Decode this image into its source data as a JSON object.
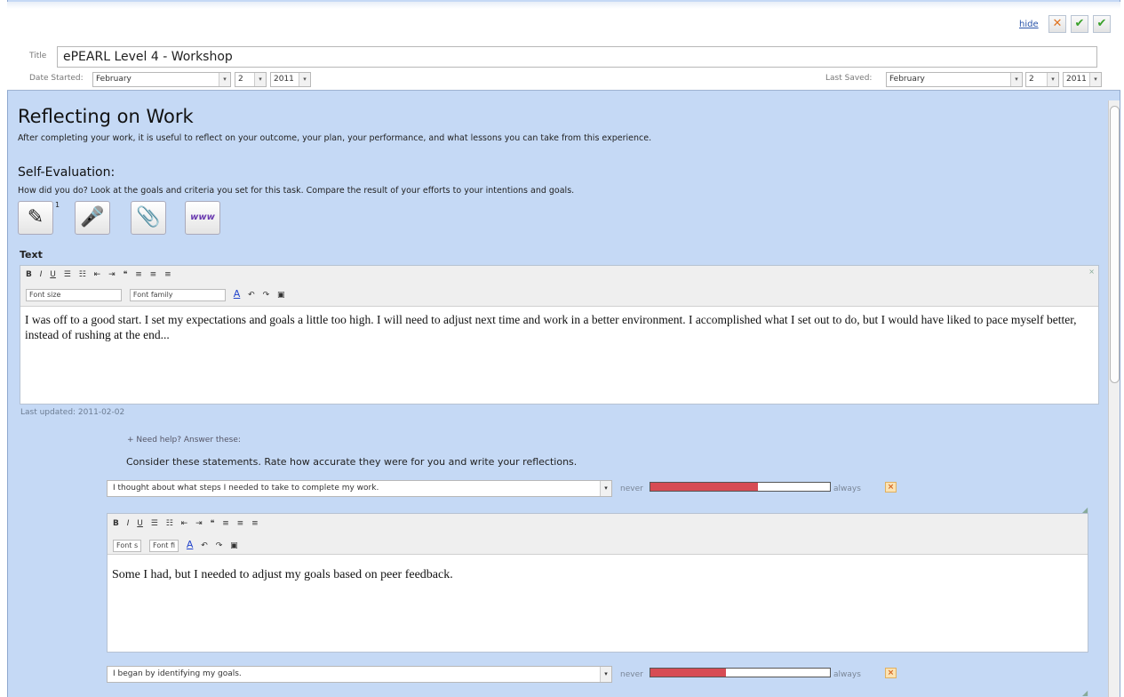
{
  "header": {
    "hide_label": "hide",
    "title_label": "Title",
    "title_value": "ePEARL Level 4 - Workshop",
    "date_started_label": "Date Started:",
    "date_started": {
      "month": "February",
      "day": "2",
      "year": "2011"
    },
    "last_saved_label": "Last Saved:",
    "last_saved": {
      "month": "February",
      "day": "2",
      "year": "2011"
    },
    "buttons": {
      "cancel_icon": "close-icon",
      "save_icon": "check-icon",
      "save_close_icon": "double-check-icon"
    }
  },
  "main": {
    "heading": "Reflecting on Work",
    "description": "After completing your work, it is useful to reflect on your outcome, your plan, your performance, and what lessons you can take from this experience.",
    "subheading": "Self-Evaluation:",
    "prompt": "How did you do? Look at the goals and criteria you set for this task. Compare the result of your efforts to your intentions and goals.",
    "tools": [
      {
        "name": "pencil-icon",
        "count": "1"
      },
      {
        "name": "microphone-icon"
      },
      {
        "name": "paperclip-icon"
      },
      {
        "name": "www-icon",
        "label": "www"
      }
    ],
    "text_label": "Text",
    "editor": {
      "font_size_placeholder": "Font size",
      "font_family_placeholder": "Font family",
      "content": "I was off to a good start. I set my expectations and goals a little too high. I will need to adjust next time and work in a better environment. I accomplished what I set out to do, but I would have liked to pace myself better, instead of rushing at the end..."
    },
    "last_updated": "Last updated: 2011-02-02",
    "need_help": "+ Need help? Answer these:",
    "consider": "Consider these statements. Rate how accurate they were for you and write your reflections.",
    "statements": [
      {
        "text": "I thought about what steps I needed to take to complete my work.",
        "rating": 0.6,
        "editor": {
          "font_size_placeholder": "Font s",
          "font_family_placeholder": "Font fi",
          "content": "Some I had, but I needed to adjust my goals based on peer feedback."
        }
      },
      {
        "text": "I began by identifying my goals.",
        "rating": 0.42
      }
    ],
    "scale_low": "never",
    "scale_high": "always"
  },
  "colors": {
    "panel_bg": "#c5d9f5",
    "rating_fill": "#d74c54",
    "link": "#2a55aa"
  }
}
